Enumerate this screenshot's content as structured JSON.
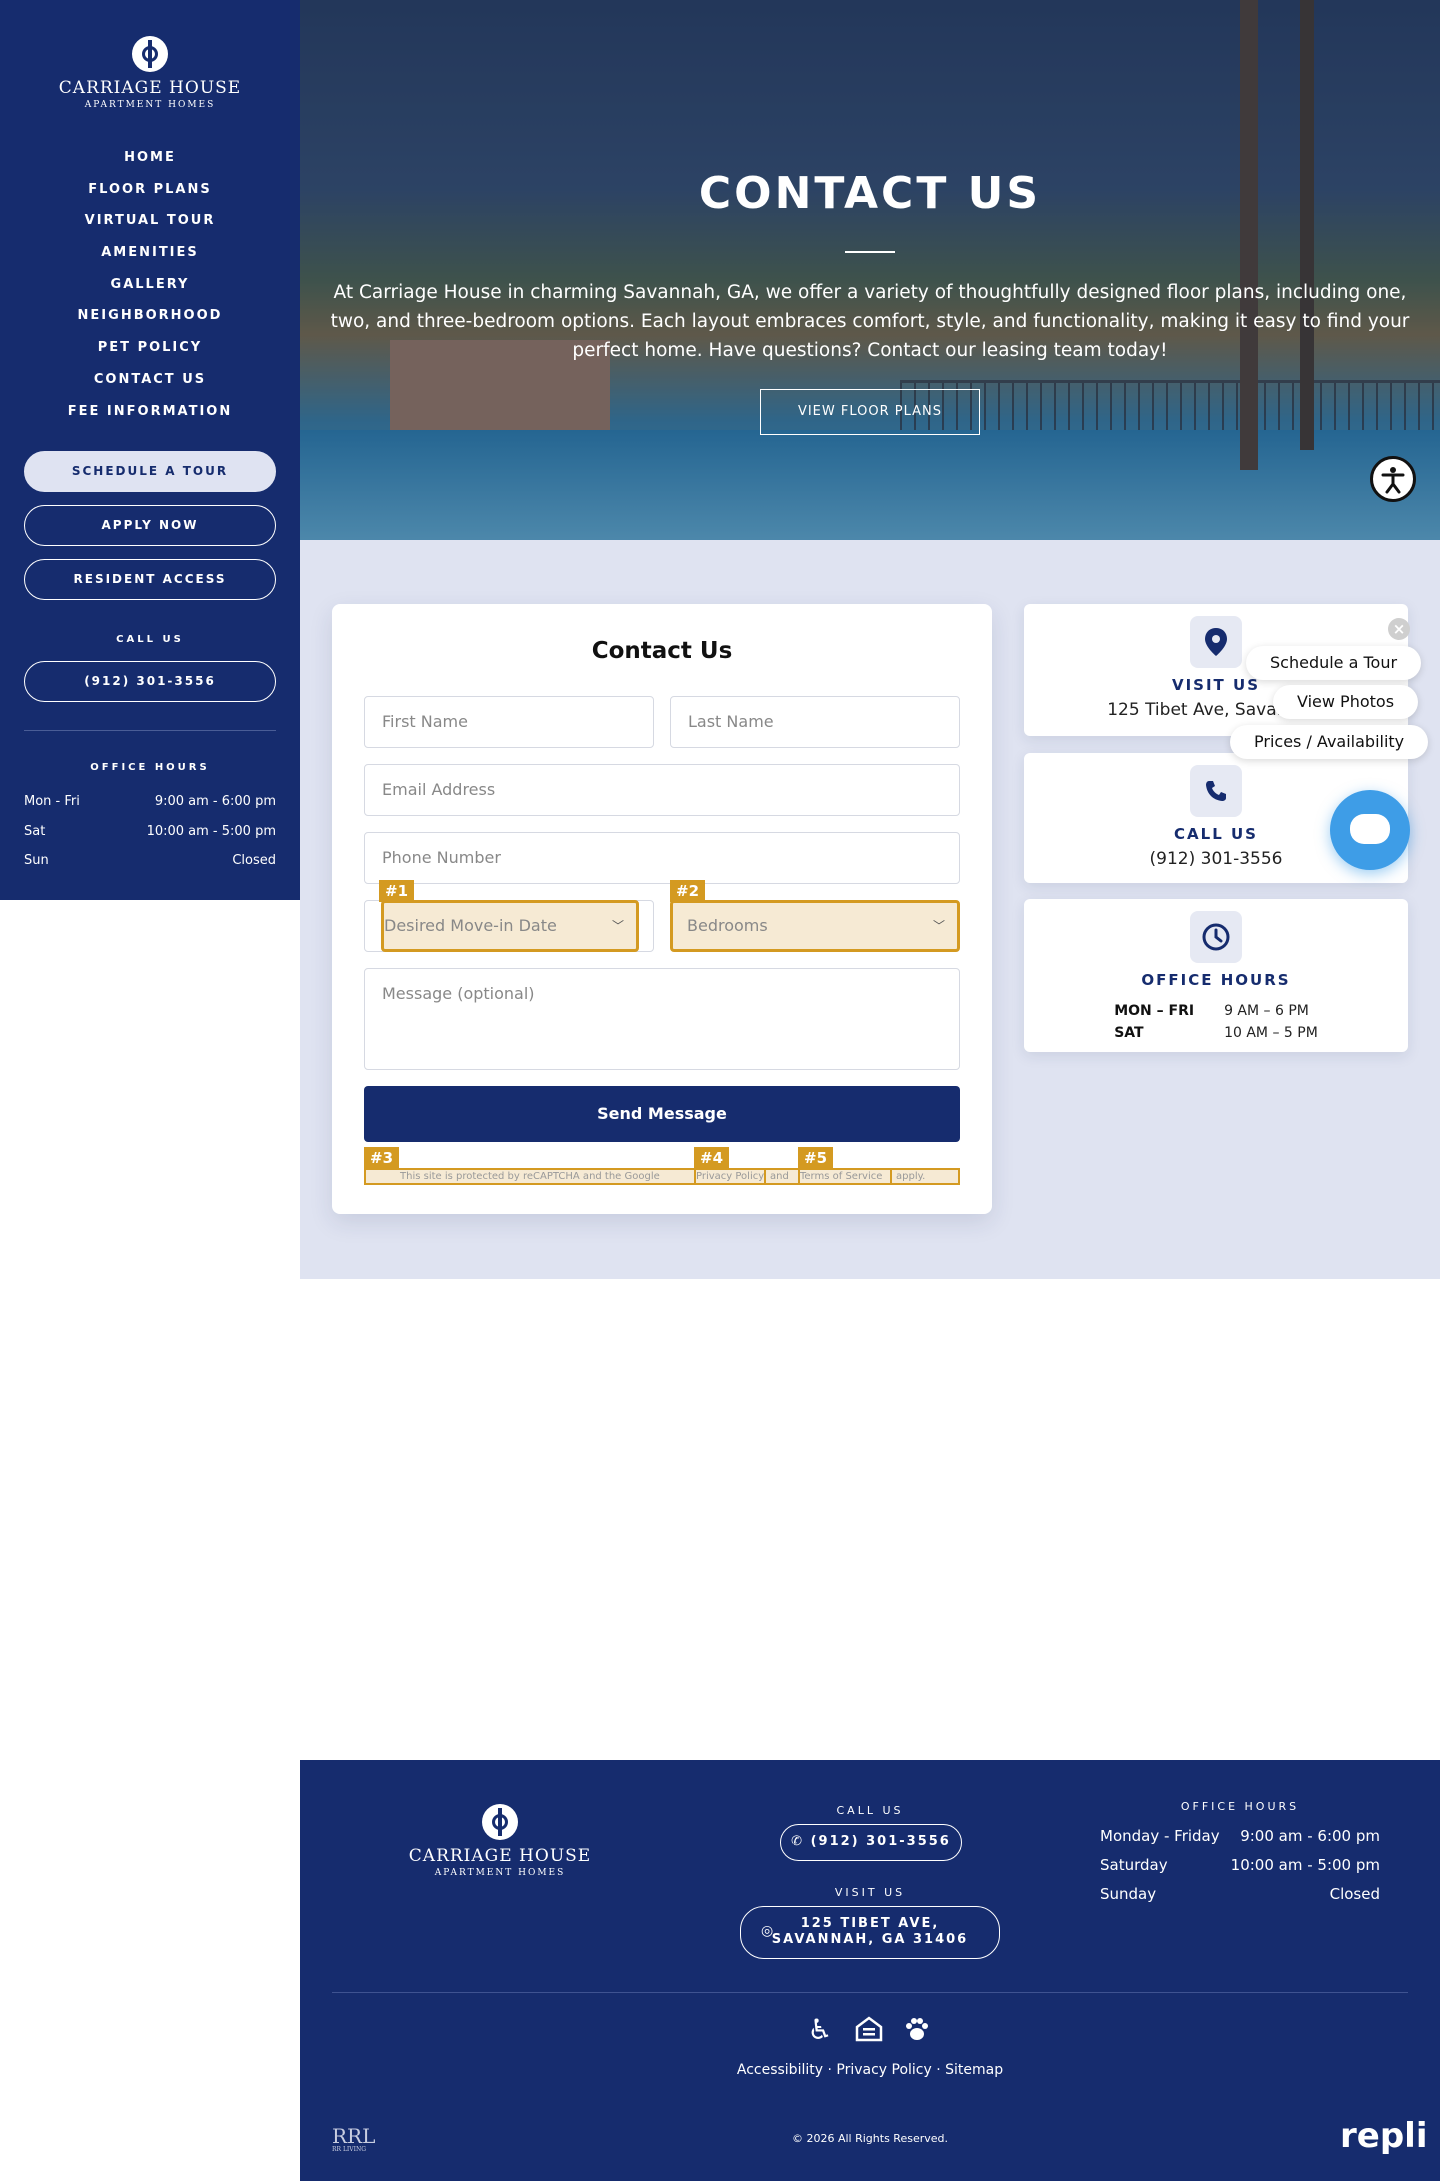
{
  "brand": {
    "name": "CARRIAGE HOUSE",
    "subtitle": "APARTMENT HOMES"
  },
  "sidebar": {
    "nav": [
      {
        "label": "HOME"
      },
      {
        "label": "FLOOR PLANS"
      },
      {
        "label": "VIRTUAL TOUR"
      },
      {
        "label": "AMENITIES"
      },
      {
        "label": "GALLERY"
      },
      {
        "label": "NEIGHBORHOOD"
      },
      {
        "label": "PET POLICY"
      },
      {
        "label": "CONTACT US"
      },
      {
        "label": "FEE INFORMATION"
      }
    ],
    "schedule_tour": "SCHEDULE A TOUR",
    "apply_now": "APPLY NOW",
    "resident_access": "RESIDENT ACCESS",
    "call_label": "CALL US",
    "phone": "(912) 301-3556",
    "office_label": "OFFICE HOURS",
    "hours": [
      {
        "day": "Mon - Fri",
        "time": "9:00 am - 6:00 pm"
      },
      {
        "day": "Sat",
        "time": "10:00 am - 5:00 pm"
      },
      {
        "day": "Sun",
        "time": "Closed"
      }
    ]
  },
  "hero": {
    "title": "CONTACT US",
    "text": "At Carriage House in charming Savannah, GA, we offer a variety of thoughtfully designed floor plans, including one, two, and three-bedroom options. Each layout embraces comfort, style, and functionality, making it easy to find your perfect home. Have questions? Contact our leasing team today!",
    "button": "VIEW FLOOR PLANS"
  },
  "form": {
    "title": "Contact Us",
    "first_name": "First Name",
    "last_name": "Last Name",
    "email": "Email Address",
    "phone": "Phone Number",
    "move_in": "Desired Move-in Date",
    "bedrooms": "Bedrooms",
    "message": "Message (optional)",
    "send": "Send Message",
    "recaptcha_pre": "This site is protected by reCAPTCHA and the Google",
    "privacy": "Privacy Policy",
    "and": "and",
    "terms": "Terms of Service",
    "apply": "apply.",
    "badges": [
      "#1",
      "#2",
      "#3",
      "#4",
      "#5"
    ]
  },
  "info": {
    "visit_title": "VISIT US",
    "visit_text": "125 Tibet Ave, Savannah,",
    "call_title": "CALL US",
    "call_text": "(912) 301-3556",
    "hours_title": "OFFICE HOURS",
    "hours": [
      {
        "day": "MON – FRI",
        "time": "9 AM – 6 PM"
      },
      {
        "day": "SAT",
        "time": "10 AM – 5 PM"
      }
    ]
  },
  "widget": {
    "pills": [
      "Schedule a Tour",
      "View Photos",
      "Prices / Availability"
    ],
    "close": "×"
  },
  "footer": {
    "call_label": "CALL US",
    "phone": "(912) 301-3556",
    "visit_label": "VISIT US",
    "address_line1": "125 TIBET AVE,",
    "address_line2": "SAVANNAH, GA 31406",
    "hours_label": "OFFICE HOURS",
    "hours": [
      {
        "day": "Monday - Friday",
        "time": "9:00 am - 6:00 pm"
      },
      {
        "day": "Saturday",
        "time": "10:00 am - 5:00 pm"
      },
      {
        "day": "Sunday",
        "time": "Closed"
      }
    ],
    "links": [
      "Accessibility",
      "Privacy Policy",
      "Sitemap"
    ],
    "separator": "·",
    "copyright": "© 2026 All Rights Reserved.",
    "rrl": "RRL",
    "rrl_sub": "RR LIVING",
    "repli": "repli"
  },
  "colors": {
    "navy": "#162c6e",
    "light_bg": "#dfe3f1",
    "highlight": "#d49a21",
    "chat_blue": "#3e9de7"
  },
  "icons": {
    "location": "location-pin-icon",
    "phone": "phone-icon",
    "clock": "clock-icon",
    "accessibility": "wheelchair-icon",
    "equal_housing": "equal-housing-icon",
    "pets": "paw-icon",
    "chat": "chat-icon"
  }
}
